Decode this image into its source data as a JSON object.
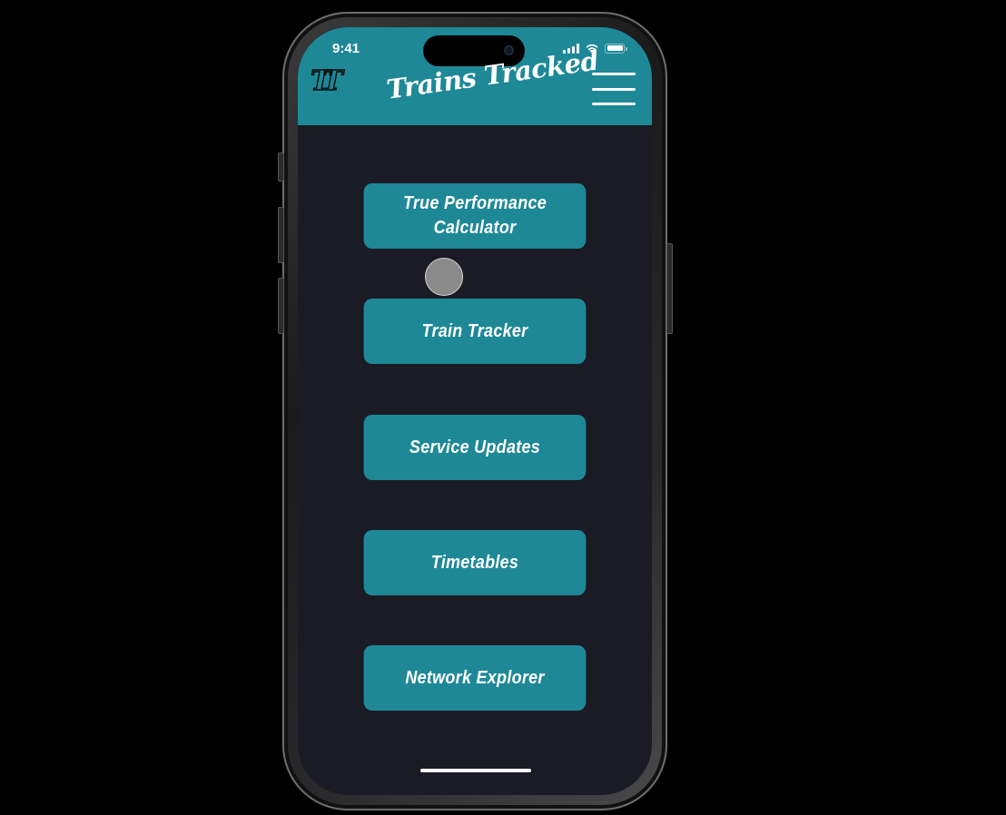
{
  "status_bar": {
    "time": "9:41"
  },
  "header": {
    "logo_text": "TT",
    "title": "Trains Tracked"
  },
  "nav": {
    "items": [
      {
        "label": "True Performance Calculator"
      },
      {
        "label": "Train Tracker"
      },
      {
        "label": "Service Updates"
      },
      {
        "label": "Timetables"
      },
      {
        "label": "Network Explorer"
      }
    ]
  },
  "colors": {
    "header_bg": "#1e8897",
    "screen_bg": "#1a1b25",
    "button_bg": "#1e8897",
    "text": "#ffffff"
  },
  "icons": [
    "signal-icon",
    "wifi-icon",
    "battery-icon",
    "menu-icon"
  ]
}
